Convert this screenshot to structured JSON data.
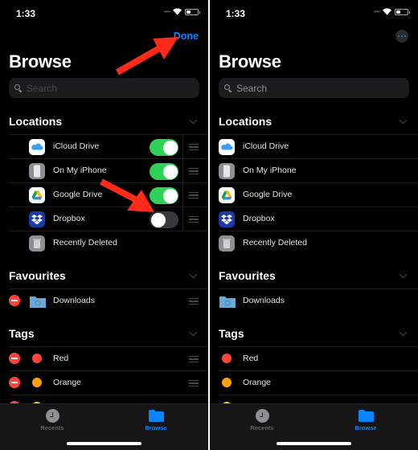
{
  "colors": {
    "accent": "#0a84ff",
    "toggle_on": "#30d158",
    "delete": "#ff453a",
    "annotation_arrow": "#ff2a1a"
  },
  "left": {
    "status": {
      "time": "1:33"
    },
    "done_label": "Done",
    "title": "Browse",
    "search": {
      "placeholder": "Search"
    },
    "locations": {
      "header": "Locations",
      "items": [
        {
          "label": "iCloud Drive",
          "icon": "icloud-icon",
          "enabled": true
        },
        {
          "label": "On My iPhone",
          "icon": "iphone-icon",
          "enabled": true
        },
        {
          "label": "Google Drive",
          "icon": "google-drive-icon",
          "enabled": true
        },
        {
          "label": "Dropbox",
          "icon": "dropbox-icon",
          "enabled": false
        },
        {
          "label": "Recently Deleted",
          "icon": "trash-icon"
        }
      ]
    },
    "favourites": {
      "header": "Favourites",
      "items": [
        {
          "label": "Downloads",
          "icon": "downloads-folder-icon"
        }
      ]
    },
    "tags": {
      "header": "Tags",
      "items": [
        {
          "label": "Red",
          "color": "#ff453a"
        },
        {
          "label": "Orange",
          "color": "#ff9f0a"
        }
      ]
    },
    "tabbar": {
      "recents": "Recents",
      "browse": "Browse",
      "active": "browse"
    }
  },
  "right": {
    "status": {
      "time": "1:33"
    },
    "title": "Browse",
    "search": {
      "placeholder": "Search"
    },
    "locations": {
      "header": "Locations",
      "items": [
        {
          "label": "iCloud Drive"
        },
        {
          "label": "On My iPhone"
        },
        {
          "label": "Google Drive"
        },
        {
          "label": "Dropbox"
        },
        {
          "label": "Recently Deleted"
        }
      ]
    },
    "favourites": {
      "header": "Favourites",
      "items": [
        {
          "label": "Downloads"
        }
      ]
    },
    "tags": {
      "header": "Tags",
      "items": [
        {
          "label": "Red",
          "color": "#ff453a"
        },
        {
          "label": "Orange",
          "color": "#ff9f0a"
        }
      ]
    },
    "tabbar": {
      "recents": "Recents",
      "browse": "Browse",
      "active": "browse"
    }
  }
}
